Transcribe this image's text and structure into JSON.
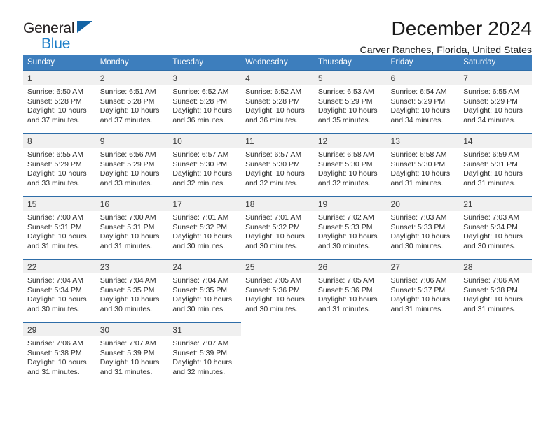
{
  "brand": {
    "name_part1": "General",
    "name_part2": "Blue",
    "logo_icon": "triangle-logo-icon"
  },
  "header": {
    "title": "December 2024",
    "subtitle": "Carver Ranches, Florida, United States"
  },
  "colors": {
    "header_blue": "#3d7ebd",
    "row_rule_blue": "#2e6da8",
    "daynum_band": "#f0f0f0",
    "brand_blue": "#1a7cc7",
    "logo_triangle": "#1464a5"
  },
  "weekdays": [
    "Sunday",
    "Monday",
    "Tuesday",
    "Wednesday",
    "Thursday",
    "Friday",
    "Saturday"
  ],
  "weeks": [
    [
      {
        "day": "1",
        "sunrise": "Sunrise: 6:50 AM",
        "sunset": "Sunset: 5:28 PM",
        "daylight_line1": "Daylight: 10 hours",
        "daylight_line2": "and 37 minutes."
      },
      {
        "day": "2",
        "sunrise": "Sunrise: 6:51 AM",
        "sunset": "Sunset: 5:28 PM",
        "daylight_line1": "Daylight: 10 hours",
        "daylight_line2": "and 37 minutes."
      },
      {
        "day": "3",
        "sunrise": "Sunrise: 6:52 AM",
        "sunset": "Sunset: 5:28 PM",
        "daylight_line1": "Daylight: 10 hours",
        "daylight_line2": "and 36 minutes."
      },
      {
        "day": "4",
        "sunrise": "Sunrise: 6:52 AM",
        "sunset": "Sunset: 5:28 PM",
        "daylight_line1": "Daylight: 10 hours",
        "daylight_line2": "and 36 minutes."
      },
      {
        "day": "5",
        "sunrise": "Sunrise: 6:53 AM",
        "sunset": "Sunset: 5:29 PM",
        "daylight_line1": "Daylight: 10 hours",
        "daylight_line2": "and 35 minutes."
      },
      {
        "day": "6",
        "sunrise": "Sunrise: 6:54 AM",
        "sunset": "Sunset: 5:29 PM",
        "daylight_line1": "Daylight: 10 hours",
        "daylight_line2": "and 34 minutes."
      },
      {
        "day": "7",
        "sunrise": "Sunrise: 6:55 AM",
        "sunset": "Sunset: 5:29 PM",
        "daylight_line1": "Daylight: 10 hours",
        "daylight_line2": "and 34 minutes."
      }
    ],
    [
      {
        "day": "8",
        "sunrise": "Sunrise: 6:55 AM",
        "sunset": "Sunset: 5:29 PM",
        "daylight_line1": "Daylight: 10 hours",
        "daylight_line2": "and 33 minutes."
      },
      {
        "day": "9",
        "sunrise": "Sunrise: 6:56 AM",
        "sunset": "Sunset: 5:29 PM",
        "daylight_line1": "Daylight: 10 hours",
        "daylight_line2": "and 33 minutes."
      },
      {
        "day": "10",
        "sunrise": "Sunrise: 6:57 AM",
        "sunset": "Sunset: 5:30 PM",
        "daylight_line1": "Daylight: 10 hours",
        "daylight_line2": "and 32 minutes."
      },
      {
        "day": "11",
        "sunrise": "Sunrise: 6:57 AM",
        "sunset": "Sunset: 5:30 PM",
        "daylight_line1": "Daylight: 10 hours",
        "daylight_line2": "and 32 minutes."
      },
      {
        "day": "12",
        "sunrise": "Sunrise: 6:58 AM",
        "sunset": "Sunset: 5:30 PM",
        "daylight_line1": "Daylight: 10 hours",
        "daylight_line2": "and 32 minutes."
      },
      {
        "day": "13",
        "sunrise": "Sunrise: 6:58 AM",
        "sunset": "Sunset: 5:30 PM",
        "daylight_line1": "Daylight: 10 hours",
        "daylight_line2": "and 31 minutes."
      },
      {
        "day": "14",
        "sunrise": "Sunrise: 6:59 AM",
        "sunset": "Sunset: 5:31 PM",
        "daylight_line1": "Daylight: 10 hours",
        "daylight_line2": "and 31 minutes."
      }
    ],
    [
      {
        "day": "15",
        "sunrise": "Sunrise: 7:00 AM",
        "sunset": "Sunset: 5:31 PM",
        "daylight_line1": "Daylight: 10 hours",
        "daylight_line2": "and 31 minutes."
      },
      {
        "day": "16",
        "sunrise": "Sunrise: 7:00 AM",
        "sunset": "Sunset: 5:31 PM",
        "daylight_line1": "Daylight: 10 hours",
        "daylight_line2": "and 31 minutes."
      },
      {
        "day": "17",
        "sunrise": "Sunrise: 7:01 AM",
        "sunset": "Sunset: 5:32 PM",
        "daylight_line1": "Daylight: 10 hours",
        "daylight_line2": "and 30 minutes."
      },
      {
        "day": "18",
        "sunrise": "Sunrise: 7:01 AM",
        "sunset": "Sunset: 5:32 PM",
        "daylight_line1": "Daylight: 10 hours",
        "daylight_line2": "and 30 minutes."
      },
      {
        "day": "19",
        "sunrise": "Sunrise: 7:02 AM",
        "sunset": "Sunset: 5:33 PM",
        "daylight_line1": "Daylight: 10 hours",
        "daylight_line2": "and 30 minutes."
      },
      {
        "day": "20",
        "sunrise": "Sunrise: 7:03 AM",
        "sunset": "Sunset: 5:33 PM",
        "daylight_line1": "Daylight: 10 hours",
        "daylight_line2": "and 30 minutes."
      },
      {
        "day": "21",
        "sunrise": "Sunrise: 7:03 AM",
        "sunset": "Sunset: 5:34 PM",
        "daylight_line1": "Daylight: 10 hours",
        "daylight_line2": "and 30 minutes."
      }
    ],
    [
      {
        "day": "22",
        "sunrise": "Sunrise: 7:04 AM",
        "sunset": "Sunset: 5:34 PM",
        "daylight_line1": "Daylight: 10 hours",
        "daylight_line2": "and 30 minutes."
      },
      {
        "day": "23",
        "sunrise": "Sunrise: 7:04 AM",
        "sunset": "Sunset: 5:35 PM",
        "daylight_line1": "Daylight: 10 hours",
        "daylight_line2": "and 30 minutes."
      },
      {
        "day": "24",
        "sunrise": "Sunrise: 7:04 AM",
        "sunset": "Sunset: 5:35 PM",
        "daylight_line1": "Daylight: 10 hours",
        "daylight_line2": "and 30 minutes."
      },
      {
        "day": "25",
        "sunrise": "Sunrise: 7:05 AM",
        "sunset": "Sunset: 5:36 PM",
        "daylight_line1": "Daylight: 10 hours",
        "daylight_line2": "and 30 minutes."
      },
      {
        "day": "26",
        "sunrise": "Sunrise: 7:05 AM",
        "sunset": "Sunset: 5:36 PM",
        "daylight_line1": "Daylight: 10 hours",
        "daylight_line2": "and 31 minutes."
      },
      {
        "day": "27",
        "sunrise": "Sunrise: 7:06 AM",
        "sunset": "Sunset: 5:37 PM",
        "daylight_line1": "Daylight: 10 hours",
        "daylight_line2": "and 31 minutes."
      },
      {
        "day": "28",
        "sunrise": "Sunrise: 7:06 AM",
        "sunset": "Sunset: 5:38 PM",
        "daylight_line1": "Daylight: 10 hours",
        "daylight_line2": "and 31 minutes."
      }
    ],
    [
      {
        "day": "29",
        "sunrise": "Sunrise: 7:06 AM",
        "sunset": "Sunset: 5:38 PM",
        "daylight_line1": "Daylight: 10 hours",
        "daylight_line2": "and 31 minutes."
      },
      {
        "day": "30",
        "sunrise": "Sunrise: 7:07 AM",
        "sunset": "Sunset: 5:39 PM",
        "daylight_line1": "Daylight: 10 hours",
        "daylight_line2": "and 31 minutes."
      },
      {
        "day": "31",
        "sunrise": "Sunrise: 7:07 AM",
        "sunset": "Sunset: 5:39 PM",
        "daylight_line1": "Daylight: 10 hours",
        "daylight_line2": "and 32 minutes."
      },
      null,
      null,
      null,
      null
    ]
  ]
}
